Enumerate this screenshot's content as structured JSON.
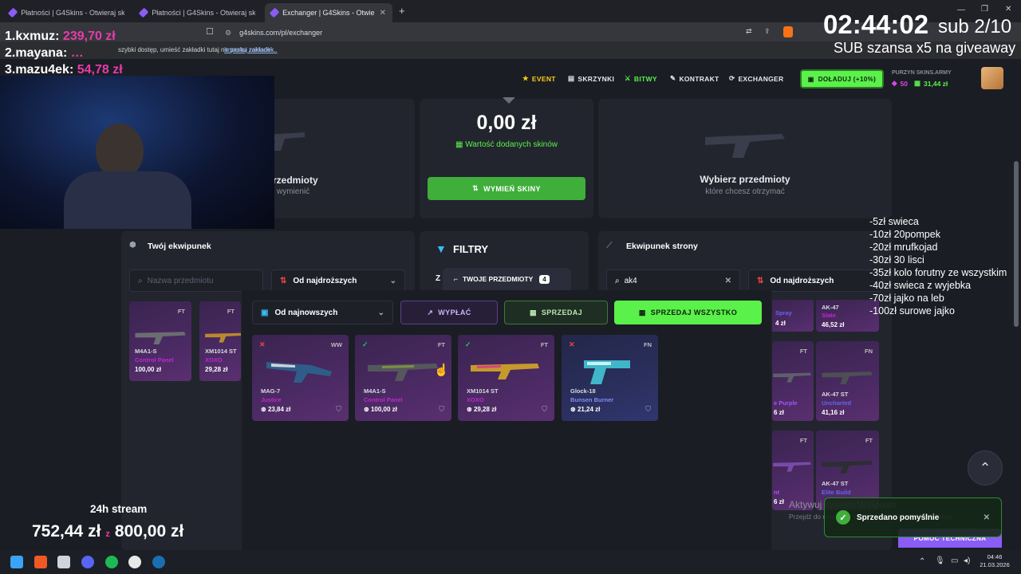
{
  "browser": {
    "tabs": [
      {
        "title": "Płatności | G4Skins - Otwieraj skrzyni…",
        "active": false
      },
      {
        "title": "Płatności | G4Skins - Otwieraj skrzyni…",
        "active": false
      },
      {
        "title": "Exchanger | G4Skins - Otwieraj s…",
        "active": true
      }
    ],
    "new_tab": "+",
    "url": "g4skins.com/pl/exchanger",
    "bookmarks_text": "szybki dostęp, umieść zakładki tutaj na pasku zakładek.",
    "bookmarks_link": "Importuj zakładki..."
  },
  "nav": {
    "event": "EVENT",
    "cases": "SKRZYNKI",
    "battles": "BITWY",
    "contract": "KONTRAKT",
    "exchanger": "EXCHANGER",
    "deposit": "DOŁADUJ (+10%)",
    "username": "PURZYN SKINS.ARMY",
    "gems": "50",
    "balance": "31,44 zł"
  },
  "exchange": {
    "left_title": "rzedmioty",
    "left_sub": "wymienić",
    "center_value": "0,00 zł",
    "center_sub": "Wartość dodanych skinów",
    "swap_button": "WYMIEŃ SKINY",
    "right_title": "Wybierz przedmioty",
    "right_sub": "które chcesz otrzymać"
  },
  "inventory": {
    "title": "Twój ekwipunek",
    "search_placeholder": "Nazwa przedmiotu",
    "sort": "Od najdroższych",
    "items": [
      {
        "wear": "FT",
        "name": "M4A1-S",
        "skin": "Control Panel",
        "price": "100,00 zł"
      },
      {
        "wear": "FT",
        "name": "XM1014 ST",
        "skin": "XOXO",
        "price": "29,28 zł"
      }
    ]
  },
  "filters": {
    "title": "FILTRY",
    "letter": "Z"
  },
  "site_inventory": {
    "title": "Ekwipunek strony",
    "search_value": "ak4",
    "sort": "Od najdroższych",
    "items": [
      {
        "wear": "",
        "name": "",
        "skin": "Spray",
        "price": "4 zł"
      },
      {
        "wear": "",
        "name": "AK-47",
        "skin": "Slate",
        "price": "46,52 zł"
      },
      {
        "wear": "FT",
        "name": "",
        "skin": "e Purple",
        "price": "6 zł"
      },
      {
        "wear": "FN",
        "name": "AK-47 ST",
        "skin": "Uncharted",
        "price": "41,16 zł"
      },
      {
        "wear": "FT",
        "name": "",
        "skin": "nt",
        "price": "6 zł"
      },
      {
        "wear": "FT",
        "name": "AK-47 ST",
        "skin": "Elite Build",
        "price": "6 zł"
      }
    ]
  },
  "my_items_popup": {
    "tab_label": "TWOJE PRZEDMIOTY",
    "count": "4",
    "sort": "Od najnowszych",
    "withdraw": "WYPŁAĆ",
    "sell": "SPRZEDAJ",
    "sell_all": "SPRZEDAJ WSZYSTKO",
    "items": [
      {
        "mark": "✕",
        "mark_color": "#ef4444",
        "wear": "WW",
        "name": "MAG-7",
        "skin": "Justice",
        "skin_color": "#c026d3",
        "price": "23,84 zł",
        "bg": "purple"
      },
      {
        "mark": "✓",
        "mark_color": "#22c55e",
        "wear": "FT",
        "name": "M4A1-S",
        "skin": "Control Panel",
        "skin_color": "#c026d3",
        "price": "100,00 zł",
        "bg": "purple"
      },
      {
        "mark": "✓",
        "mark_color": "#22c55e",
        "wear": "FT",
        "name": "XM1014 ST",
        "skin": "XOXO",
        "skin_color": "#c026d3",
        "price": "29,28 zł",
        "bg": "purple"
      },
      {
        "mark": "✕",
        "mark_color": "#ef4444",
        "wear": "FN",
        "name": "Glock-18",
        "skin": "Bunsen Burner",
        "skin_color": "#6366f1",
        "price": "21,24 zł",
        "bg": "blue"
      }
    ]
  },
  "toast": "Sprzedano pomyślnie",
  "windows_watermark": {
    "title": "Aktywuj system Windows",
    "sub": "Przejdź do ustawień, aby aktywować system Windows."
  },
  "support_button": "POMOC TECHNICZNA",
  "stream": {
    "timer": "02:44:02",
    "sub_goal": "sub 2/10",
    "giveaway": "SUB szansa x5 na giveaway",
    "leaderboard": [
      {
        "rank": "1.",
        "name": "kxmuz:",
        "amount": "239,70 zł"
      },
      {
        "rank": "2.",
        "name": "mayana:",
        "amount": "…"
      },
      {
        "rank": "3.",
        "name": "mazu4ek:",
        "amount": "54,78 zł"
      }
    ],
    "goal_label": "24h stream",
    "goal_current": "752,44 zł",
    "goal_sep": "z",
    "goal_target": "800,00 zł",
    "donation_list": [
      "-5zł swieca",
      "-10zł 20pompek",
      "-20zł mrufkojad",
      "-30zł 30 lisci",
      "-35zł kolo forutny ze wszystkim",
      "-40zł swieca z wyjebka",
      "-70zł jajko na leb",
      "-100zł surowe jajko"
    ]
  },
  "taskbar": {
    "time": "04:46",
    "date": "21.03.2026"
  },
  "colors": {
    "accent_green": "#5af14a",
    "accent_purple": "#8b5cf6",
    "bg": "#1b1d24",
    "panel": "#22252e"
  }
}
